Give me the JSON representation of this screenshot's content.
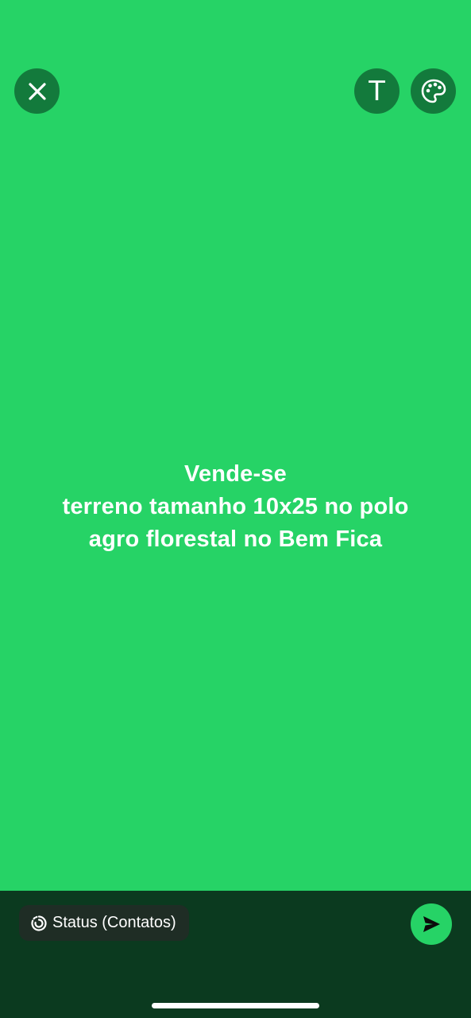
{
  "status": {
    "text_lines": [
      "Vende-se",
      "terreno tamanho 10x25 no polo",
      "agro florestal no Bem Fica"
    ],
    "background_color": "#26d366"
  },
  "toolbar": {
    "close_icon": "close-icon",
    "text_tool_label": "T",
    "palette_icon": "palette-icon"
  },
  "bottom_bar": {
    "audience_label": "Status (Contatos)",
    "audience_icon": "status-ring-icon",
    "send_icon": "send-icon",
    "background_color": "#0b3a1f"
  }
}
